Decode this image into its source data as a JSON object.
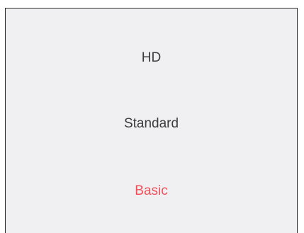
{
  "quality_menu": {
    "options": [
      {
        "label": "HD",
        "selected": false
      },
      {
        "label": "Standard",
        "selected": false
      },
      {
        "label": "Basic",
        "selected": true
      }
    ],
    "colors": {
      "background": "#f0eff2",
      "text": "#3c3c3c",
      "selected_text": "#f1505a"
    }
  }
}
